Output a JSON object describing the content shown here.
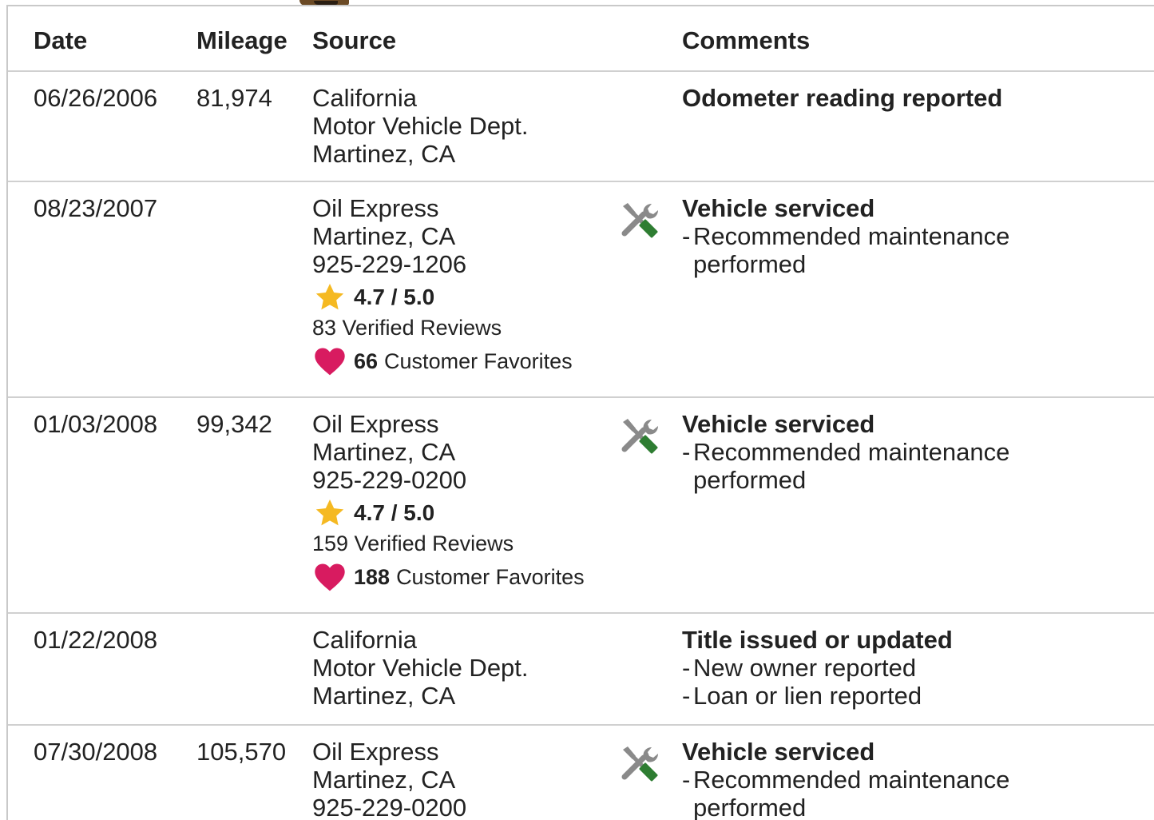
{
  "columns": {
    "date": "Date",
    "mileage": "Mileage",
    "source": "Source",
    "comments": "Comments"
  },
  "colors": {
    "star": "#f5b922",
    "heart": "#d81b60",
    "wrench_handle": "#2e7d32",
    "tool_gray": "#8a8a8a",
    "divider": "#d0d0d0"
  },
  "rows": [
    {
      "date": "06/26/2006",
      "mileage": "81,974",
      "source": [
        "California",
        "Motor Vehicle Dept.",
        "Martinez, CA"
      ],
      "icon": "",
      "comment_title": "Odometer reading reported",
      "comment_items": []
    },
    {
      "date": "08/23/2007",
      "mileage": "",
      "source": [
        "Oil Express",
        "Martinez, CA",
        "925-229-1206"
      ],
      "rating": "4.7 / 5.0",
      "reviews": "83 Verified Reviews",
      "favorites_count": "66",
      "favorites_label": "Customer Favorites",
      "icon": "service-tools-icon",
      "comment_title": "Vehicle serviced",
      "comment_items": [
        [
          "Recommended maintenance",
          "performed"
        ]
      ]
    },
    {
      "date": "01/03/2008",
      "mileage": "99,342",
      "source": [
        "Oil Express",
        "Martinez, CA",
        "925-229-0200"
      ],
      "rating": "4.7 / 5.0",
      "reviews": "159 Verified Reviews",
      "favorites_count": "188",
      "favorites_label": "Customer Favorites",
      "icon": "service-tools-icon",
      "comment_title": "Vehicle serviced",
      "comment_items": [
        [
          "Recommended maintenance",
          "performed"
        ]
      ]
    },
    {
      "date": "01/22/2008",
      "mileage": "",
      "source": [
        "California",
        "Motor Vehicle Dept.",
        "Martinez, CA"
      ],
      "icon": "",
      "comment_title": "Title issued or updated",
      "comment_items": [
        [
          "New owner reported"
        ],
        [
          "Loan or lien reported"
        ]
      ]
    },
    {
      "date": "07/30/2008",
      "mileage": "105,570",
      "source": [
        "Oil Express",
        "Martinez, CA",
        "925-229-0200"
      ],
      "icon": "service-tools-icon",
      "comment_title": "Vehicle serviced",
      "comment_items": [
        [
          "Recommended maintenance",
          "performed"
        ]
      ]
    }
  ],
  "bullet_dash": "-"
}
